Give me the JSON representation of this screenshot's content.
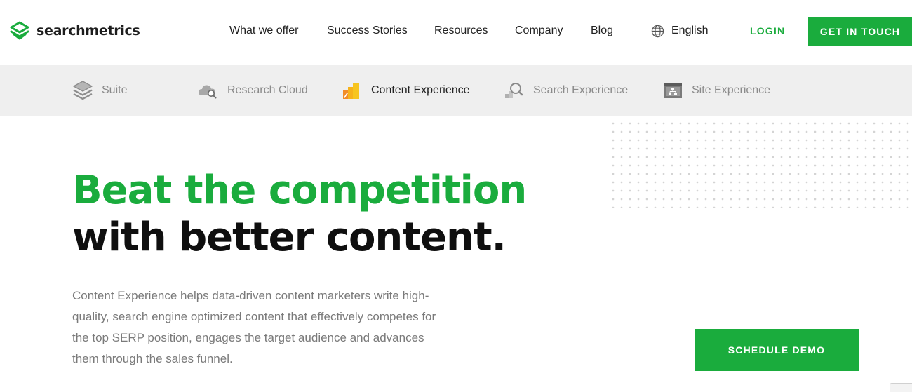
{
  "brand": {
    "name": "searchmetrics",
    "accent": "#1aac3d"
  },
  "nav": {
    "items": [
      "What we offer",
      "Success Stories",
      "Resources",
      "Company",
      "Blog"
    ],
    "language": "English",
    "login": "LOGIN",
    "cta": "GET IN TOUCH"
  },
  "products": [
    {
      "label": "Suite",
      "icon": "stacked-layers-icon",
      "active": false
    },
    {
      "label": "Research Cloud",
      "icon": "cloud-search-icon",
      "active": false
    },
    {
      "label": "Content Experience",
      "icon": "content-bars-icon",
      "active": true
    },
    {
      "label": "Search Experience",
      "icon": "magnifier-bars-icon",
      "active": false
    },
    {
      "label": "Site Experience",
      "icon": "site-structure-icon",
      "active": false
    }
  ],
  "hero": {
    "headline_highlight": "Beat the competition",
    "headline_rest": " with better content.",
    "description": "Content Experience helps data-driven content marketers write high-quality, search engine optimized content that effectively competes for the top SERP position, engages the target audience and advances them through the sales funnel.",
    "cta": "SCHEDULE DEMO"
  }
}
